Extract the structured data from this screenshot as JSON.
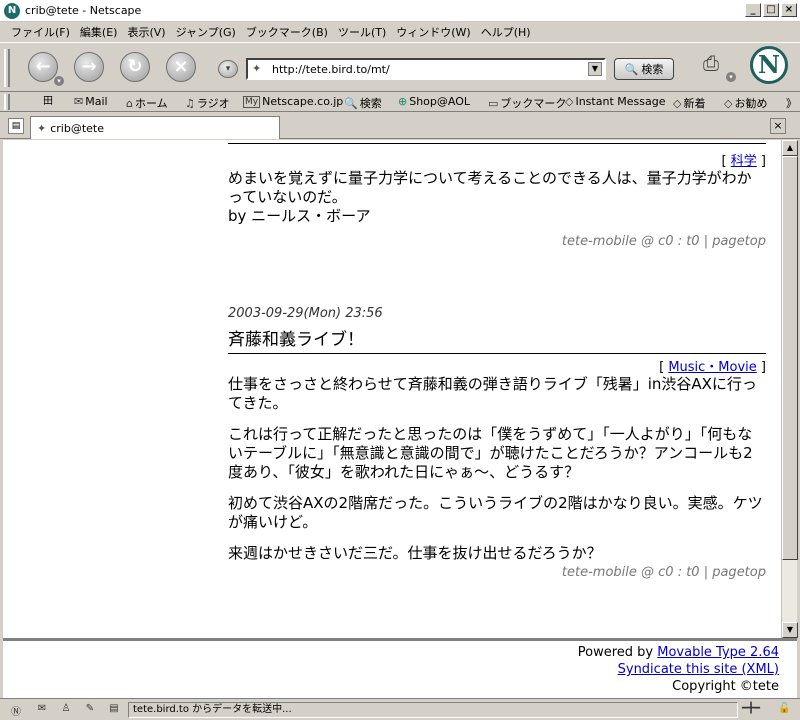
{
  "window": {
    "title": "crib@tete - Netscape",
    "min_label": "_",
    "max_label": "□",
    "close_label": "×"
  },
  "menu": [
    "ファイル(F)",
    "編集(E)",
    "表示(V)",
    "ジャンプ(G)",
    "ブックマーク(B)",
    "ツール(T)",
    "ウィンドウ(W)",
    "ヘルプ(H)"
  ],
  "nav": {
    "url": "http://tete.bird.to/mt/",
    "search_label": "検索",
    "back_glyph": "←",
    "forward_glyph": "→",
    "reload_glyph": "↻",
    "stop_glyph": "×",
    "logo_letter": "N"
  },
  "personal_bar": [
    {
      "icon": "✉",
      "label": "Mail"
    },
    {
      "icon": "⌂",
      "label": "ホーム"
    },
    {
      "icon": "♫",
      "label": "ラジオ"
    },
    {
      "icon": "My",
      "label": "Netscape.co.jp"
    },
    {
      "icon": "🔍",
      "label": "検索"
    },
    {
      "icon": "⊕",
      "label": "Shop@AOL"
    },
    {
      "icon": "▭",
      "label": "ブックマーク"
    },
    {
      "icon": "◇",
      "label": "Instant Message"
    },
    {
      "icon": "◇",
      "label": "新着"
    },
    {
      "icon": "◇",
      "label": "お勧め"
    }
  ],
  "tab": {
    "label": "crib@tete",
    "close_label": "×"
  },
  "posts": [
    {
      "category": "科学",
      "paragraphs": [
        "めまいを覚えずに量子力学について考えることのできる人は、量子力学がわかっていないのだ。",
        "by ニールス・ボーア"
      ],
      "footer": "tete-mobile @ c0 : t0 | pagetop"
    },
    {
      "date": "2003-09-29(Mon) 23:56",
      "title": "斉藤和義ライブ！",
      "category": "Music・Movie",
      "paragraphs": [
        "仕事をさっさと終わらせて斉藤和義の弾き語りライブ「残暑」in渋谷AXに行ってきた。",
        "これは行って正解だったと思ったのは「僕をうずめて」「一人よがり」「何もないテーブルに」「無意識と意識の間で」が聴けたことだろうか？アンコールも2度あり、「彼女」を歌われた日にゃぁ〜、どうるす？",
        "初めて渋谷AXの2階席だった。こういうライブの2階はかなり良い。実感。ケツが痛いけど。",
        "来週はかせきさいだ三だ。仕事を抜け出せるだろうか？"
      ],
      "footer": "tete-mobile @ c0 : t0 | pagetop"
    }
  ],
  "footer": {
    "powered_prefix": "Powered by ",
    "powered_link": "Movable Type 2.64",
    "syndicate": "Syndicate this site (XML)",
    "copyright": "Copyright ©tete"
  },
  "status": {
    "text": "tete.bird.to からデータを転送中..."
  }
}
